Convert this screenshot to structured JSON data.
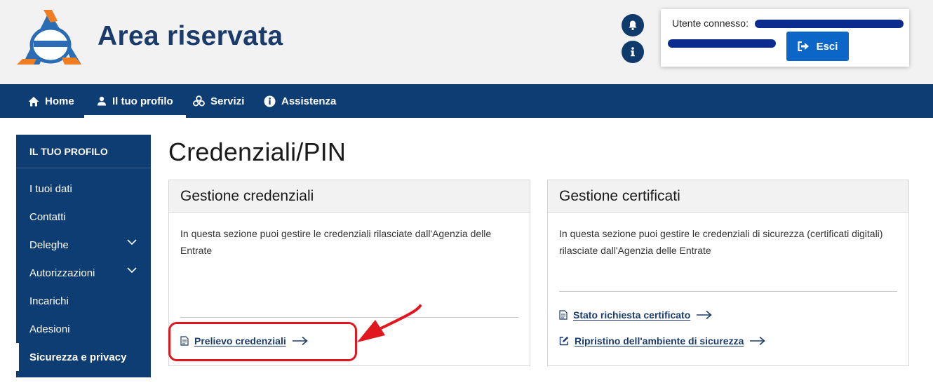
{
  "header": {
    "app_title": "Area riservata",
    "notification_icon": "bell-icon",
    "info_icon": "info-icon",
    "user": {
      "label": "Utente connesso:",
      "logout_label": "Esci",
      "logout_icon": "sign-out-icon"
    }
  },
  "nav": {
    "items": [
      {
        "label": "Home",
        "icon": "home-icon"
      },
      {
        "label": "Il tuo profilo",
        "icon": "user-icon",
        "active": true
      },
      {
        "label": "Servizi",
        "icon": "services-icon"
      },
      {
        "label": "Assistenza",
        "icon": "info-icon"
      }
    ]
  },
  "sidebar": {
    "title": "IL TUO PROFILO",
    "items": [
      {
        "label": "I tuoi dati"
      },
      {
        "label": "Contatti"
      },
      {
        "label": "Deleghe",
        "expandable": true
      },
      {
        "label": "Autorizzazioni",
        "expandable": true
      },
      {
        "label": "Incarichi"
      },
      {
        "label": "Adesioni"
      },
      {
        "label": "Sicurezza e privacy",
        "active": true
      }
    ]
  },
  "main": {
    "title": "Credenziali/PIN",
    "cards": [
      {
        "title": "Gestione credenziali",
        "text": "In questa sezione puoi gestire le credenziali rilasciate dall'Agenzia delle Entrate",
        "links": [
          {
            "label": "Prelievo credenziali",
            "icon": "document-icon"
          }
        ]
      },
      {
        "title": "Gestione certificati",
        "text": "In questa sezione puoi gestire le credenziali di sicurezza (certificati digitali) rilasciate dall'Agenzia delle Entrate",
        "links": [
          {
            "label": "Stato richiesta certificato",
            "icon": "document-icon"
          },
          {
            "label": "Ripristino dell'ambiente di sicurezza",
            "icon": "edit-icon"
          }
        ]
      }
    ]
  },
  "colors": {
    "primary": "#0d3d73",
    "button": "#0b66c8",
    "annotation": "#e0171f",
    "redaction": "#0c2b8f"
  }
}
